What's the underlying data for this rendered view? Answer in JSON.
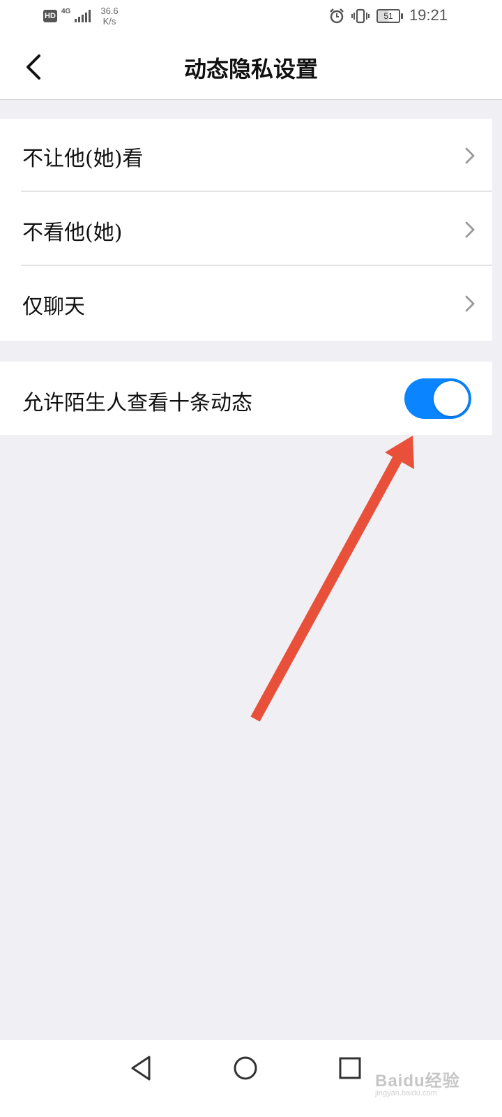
{
  "status_bar": {
    "hd_badge": "HD",
    "network_type": "4G",
    "net_speed_value": "36.6",
    "net_speed_unit": "K/s",
    "battery_level": "51",
    "time": "19:21",
    "icons": [
      "alarm-icon",
      "vibrate-icon",
      "battery-icon",
      "signal-icon"
    ]
  },
  "header": {
    "title": "动态隐私设置",
    "back_icon": "back-arrow-icon"
  },
  "privacy_options": [
    {
      "label": "不让他(她)看",
      "icon": "chevron-right-icon"
    },
    {
      "label": "不看他(她)",
      "icon": "chevron-right-icon"
    },
    {
      "label": "仅聊天",
      "icon": "chevron-right-icon"
    }
  ],
  "stranger_setting": {
    "label": "允许陌生人查看十条动态",
    "toggle_on": true
  },
  "colors": {
    "accent": "#0a84ff",
    "annotation_arrow": "#e8503a",
    "background": "#f0eff4"
  },
  "navigation_bar": {
    "icons": [
      "nav-back-icon",
      "nav-home-icon",
      "nav-recents-icon"
    ]
  },
  "watermark": {
    "text": "Baidu经验",
    "subtext": "jingyan.baidu.com"
  }
}
